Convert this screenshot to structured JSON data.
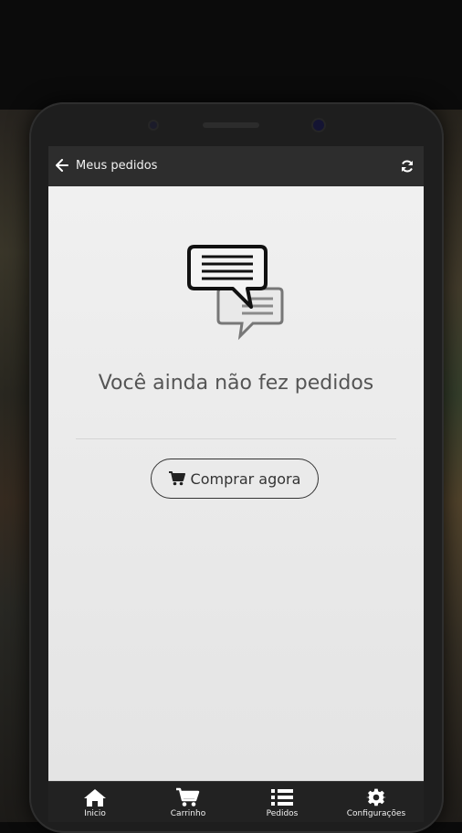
{
  "appbar": {
    "title": "Meus pedidos"
  },
  "empty_state": {
    "message": "Você ainda não fez pedidos",
    "cta_label": "Comprar agora"
  },
  "bottom_nav": [
    {
      "label": "Inicio",
      "icon": "home-icon"
    },
    {
      "label": "Carrinho",
      "icon": "cart-icon"
    },
    {
      "label": "Pedidos",
      "icon": "list-icon"
    },
    {
      "label": "Configurações",
      "icon": "gear-icon"
    }
  ],
  "colors": {
    "appbar": "#2d2d2d",
    "background": "#e6e6e6",
    "nav": "#222222",
    "text": "#555555"
  }
}
